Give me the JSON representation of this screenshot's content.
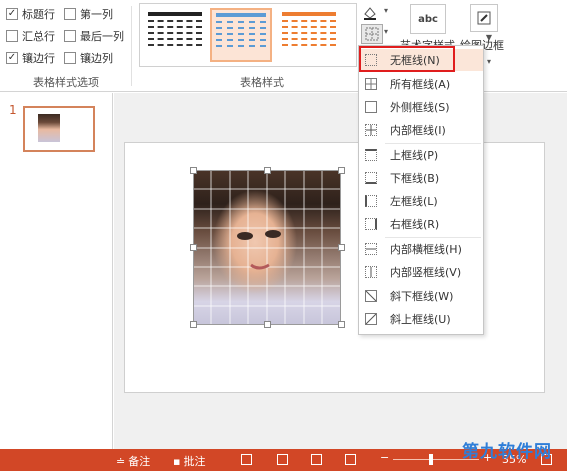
{
  "table_style_options": {
    "group_label": "表格样式选项",
    "options": [
      {
        "label": "标题行",
        "checked": true
      },
      {
        "label": "第一列",
        "checked": false
      },
      {
        "label": "汇总行",
        "checked": false
      },
      {
        "label": "最后一列",
        "checked": false
      },
      {
        "label": "镶边行",
        "checked": true
      },
      {
        "label": "镶边列",
        "checked": false
      }
    ]
  },
  "table_styles": {
    "group_label": "表格样式",
    "styles": [
      {
        "color": "#222222"
      },
      {
        "color": "#5b9bd5",
        "selected": true
      },
      {
        "color": "#ed7d31"
      }
    ]
  },
  "ribbon_right": {
    "art_label": "艺术字样式",
    "art_icon": "abc",
    "draw_border_label": "绘图边框"
  },
  "slide_pane": {
    "slide_number": "1"
  },
  "border_menu": {
    "items": [
      {
        "label": "无框线(N)",
        "icon": "no-border-icon"
      },
      {
        "label": "所有框线(A)",
        "icon": "all-borders-icon"
      },
      {
        "label": "外侧框线(S)",
        "icon": "outside-borders-icon"
      },
      {
        "label": "内部框线(I)",
        "icon": "inside-borders-icon"
      },
      {
        "label": "上框线(P)",
        "icon": "top-border-icon"
      },
      {
        "label": "下框线(B)",
        "icon": "bottom-border-icon"
      },
      {
        "label": "左框线(L)",
        "icon": "left-border-icon"
      },
      {
        "label": "右框线(R)",
        "icon": "right-border-icon"
      },
      {
        "label": "内部横框线(H)",
        "icon": "inside-horizontal-border-icon"
      },
      {
        "label": "内部竖框线(V)",
        "icon": "inside-vertical-border-icon"
      },
      {
        "label": "斜下框线(W)",
        "icon": "diagonal-down-border-icon"
      },
      {
        "label": "斜上框线(U)",
        "icon": "diagonal-up-border-icon"
      }
    ]
  },
  "status_bar": {
    "notes_label": "备注",
    "comments_label": "批注",
    "zoom": "35%",
    "minus": "−",
    "plus": "+"
  },
  "watermark": "第九软件网",
  "colors": {
    "status_bar": "#d24726",
    "highlight": "#e01d1d",
    "accent": "#d4835b"
  }
}
